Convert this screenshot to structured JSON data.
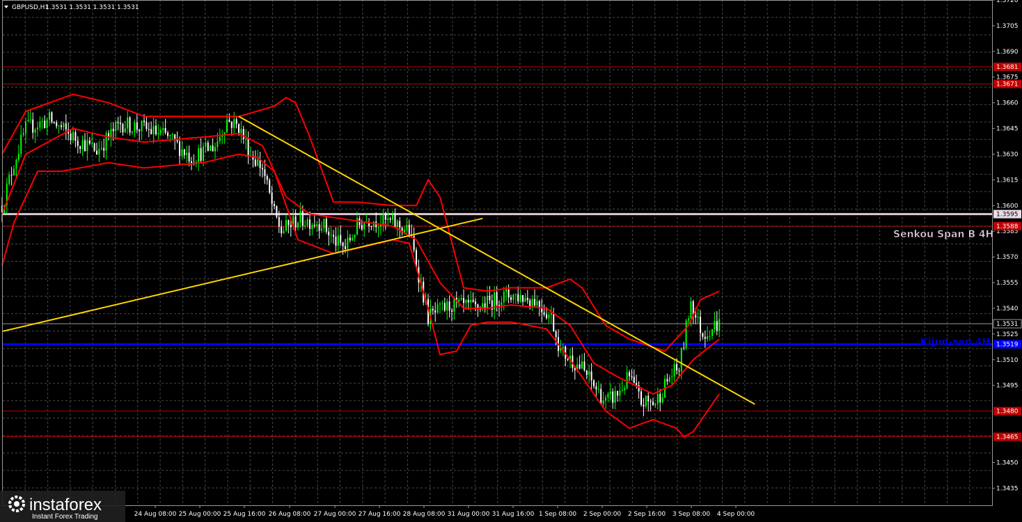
{
  "header": {
    "symbol_timeframe": "GBPUSD,H1",
    "ohlc": "1.3531 1.3531 1.3531 1.3531"
  },
  "colors": {
    "background": "#000000",
    "grid": "#4a4a4a",
    "bull_candle": "#00ff00",
    "bear_candle": "#ffffff",
    "bands": "#ff0000",
    "trendlines": "#ffd700",
    "kijun": "#0000ff",
    "senkou": "#e0c8d8",
    "level_lines": "#c00000"
  },
  "chart_data": {
    "type": "candlestick",
    "title": "",
    "xlabel": "",
    "ylabel": "",
    "ylim": [
      1.3425,
      1.372
    ],
    "grid": true,
    "x_tick_labels": [
      "24 Aug 08:00",
      "25 Aug 00:00",
      "25 Aug 16:00",
      "26 Aug 08:00",
      "27 Aug 00:00",
      "27 Aug 16:00",
      "28 Aug 08:00",
      "31 Aug 00:00",
      "31 Aug 16:00",
      "1 Sep 08:00",
      "2 Sep 00:00",
      "2 Sep 16:00",
      "3 Sep 08:00",
      "4 Sep 00:00"
    ],
    "y_ticks": [
      "1.3720",
      "1.3705",
      "1.3690",
      "1.3675",
      "1.3660",
      "1.3645",
      "1.3630",
      "1.3615",
      "1.3600",
      "1.3585",
      "1.3570",
      "1.3555",
      "1.3540",
      "1.3525",
      "1.3510",
      "1.3495",
      "1.3450",
      "1.3435"
    ],
    "levels": [
      {
        "value": 1.3681,
        "label": "1.3681",
        "type": "resistance"
      },
      {
        "value": 1.3671,
        "label": "1.3671",
        "type": "resistance"
      },
      {
        "value": 1.3595,
        "label": "1.3595",
        "type": "senkou_span_b"
      },
      {
        "value": 1.3588,
        "label": "1.3588",
        "type": "level"
      },
      {
        "value": 1.3531,
        "label": "1.3531",
        "type": "current_price"
      },
      {
        "value": 1.3519,
        "label": "1.3519",
        "type": "kijun_sen"
      },
      {
        "value": 1.348,
        "label": "1.3480",
        "type": "support"
      },
      {
        "value": 1.3465,
        "label": "1.3465",
        "type": "support"
      }
    ],
    "annotations": {
      "senkou": "Senkou Span B 4H",
      "kijun": "Kijun-sen 4H"
    },
    "close_path": [
      [
        0,
        1.36
      ],
      [
        5,
        1.3625
      ],
      [
        10,
        1.3645
      ],
      [
        20,
        1.365
      ],
      [
        30,
        1.364
      ],
      [
        40,
        1.3632
      ],
      [
        50,
        1.3648
      ],
      [
        60,
        1.3645
      ],
      [
        70,
        1.364
      ],
      [
        80,
        1.3628
      ],
      [
        90,
        1.3635
      ],
      [
        95,
        1.365
      ],
      [
        100,
        1.3646
      ],
      [
        105,
        1.363
      ],
      [
        110,
        1.3622
      ],
      [
        115,
        1.3595
      ],
      [
        118,
        1.3585
      ],
      [
        125,
        1.3592
      ],
      [
        135,
        1.359
      ],
      [
        140,
        1.358
      ],
      [
        145,
        1.3575
      ],
      [
        150,
        1.3588
      ],
      [
        155,
        1.3592
      ],
      [
        165,
        1.359
      ],
      [
        172,
        1.3585
      ],
      [
        176,
        1.356
      ],
      [
        180,
        1.3535
      ],
      [
        190,
        1.3542
      ],
      [
        200,
        1.354
      ],
      [
        210,
        1.3546
      ],
      [
        215,
        1.3548
      ],
      [
        225,
        1.3545
      ],
      [
        232,
        1.3535
      ],
      [
        236,
        1.3515
      ],
      [
        245,
        1.3505
      ],
      [
        250,
        1.3495
      ],
      [
        255,
        1.3485
      ],
      [
        260,
        1.349
      ],
      [
        265,
        1.35
      ],
      [
        270,
        1.3485
      ],
      [
        276,
        1.3485
      ],
      [
        282,
        1.35
      ],
      [
        286,
        1.3505
      ],
      [
        288,
        1.352
      ],
      [
        291,
        1.3545
      ],
      [
        293,
        1.3535
      ],
      [
        296,
        1.3525
      ],
      [
        301,
        1.353
      ],
      [
        303,
        1.3531
      ]
    ],
    "series": [
      {
        "name": "",
        "kind": "trendline",
        "points": [
          [
            0,
            1.35265
          ],
          [
            203,
            1.35925
          ]
        ]
      },
      {
        "name": "",
        "kind": "trendline",
        "points": [
          [
            100,
            1.3652
          ],
          [
            318,
            1.3484
          ]
        ]
      },
      {
        "name": "",
        "kind": "band_upper",
        "points": [
          [
            0,
            1.363
          ],
          [
            10,
            1.3655
          ],
          [
            30,
            1.3665
          ],
          [
            45,
            1.366
          ],
          [
            60,
            1.3652
          ],
          [
            85,
            1.3652
          ],
          [
            100,
            1.3652
          ],
          [
            115,
            1.3658
          ],
          [
            120,
            1.3663
          ],
          [
            124,
            1.366
          ],
          [
            130,
            1.364
          ],
          [
            140,
            1.3602
          ],
          [
            150,
            1.3602
          ],
          [
            165,
            1.36
          ],
          [
            175,
            1.36
          ],
          [
            180,
            1.3615
          ],
          [
            185,
            1.3605
          ],
          [
            195,
            1.3552
          ],
          [
            205,
            1.355
          ],
          [
            215,
            1.3552
          ],
          [
            230,
            1.3552
          ],
          [
            240,
            1.3557
          ],
          [
            245,
            1.3552
          ],
          [
            255,
            1.353
          ],
          [
            265,
            1.3522
          ],
          [
            280,
            1.3515
          ],
          [
            290,
            1.353
          ],
          [
            295,
            1.3545
          ],
          [
            303,
            1.355
          ]
        ]
      },
      {
        "name": "",
        "kind": "band_middle",
        "points": [
          [
            0,
            1.3595
          ],
          [
            10,
            1.363
          ],
          [
            30,
            1.3645
          ],
          [
            45,
            1.364
          ],
          [
            60,
            1.3637
          ],
          [
            85,
            1.364
          ],
          [
            100,
            1.3642
          ],
          [
            110,
            1.3635
          ],
          [
            120,
            1.3605
          ],
          [
            130,
            1.3595
          ],
          [
            145,
            1.3592
          ],
          [
            165,
            1.3588
          ],
          [
            175,
            1.358
          ],
          [
            185,
            1.3555
          ],
          [
            195,
            1.354
          ],
          [
            205,
            1.354
          ],
          [
            215,
            1.3542
          ],
          [
            230,
            1.354
          ],
          [
            240,
            1.353
          ],
          [
            250,
            1.3508
          ],
          [
            260,
            1.35
          ],
          [
            275,
            1.349
          ],
          [
            283,
            1.3495
          ],
          [
            292,
            1.351
          ],
          [
            303,
            1.3522
          ]
        ]
      },
      {
        "name": "",
        "kind": "band_lower",
        "points": [
          [
            0,
            1.3565
          ],
          [
            5,
            1.359
          ],
          [
            15,
            1.362
          ],
          [
            25,
            1.362
          ],
          [
            45,
            1.3625
          ],
          [
            60,
            1.3622
          ],
          [
            85,
            1.3625
          ],
          [
            100,
            1.363
          ],
          [
            108,
            1.3628
          ],
          [
            115,
            1.362
          ],
          [
            125,
            1.358
          ],
          [
            140,
            1.3572
          ],
          [
            150,
            1.3575
          ],
          [
            165,
            1.358
          ],
          [
            172,
            1.3578
          ],
          [
            180,
            1.354
          ],
          [
            185,
            1.3513
          ],
          [
            192,
            1.3515
          ],
          [
            198,
            1.353
          ],
          [
            205,
            1.3532
          ],
          [
            215,
            1.3532
          ],
          [
            230,
            1.3528
          ],
          [
            240,
            1.351
          ],
          [
            255,
            1.348
          ],
          [
            265,
            1.347
          ],
          [
            275,
            1.3475
          ],
          [
            285,
            1.347
          ],
          [
            288,
            1.3465
          ],
          [
            292,
            1.3468
          ],
          [
            303,
            1.349
          ]
        ]
      }
    ]
  },
  "watermark": {
    "brand": "instaforex",
    "tagline": "Instant Forex Trading"
  }
}
